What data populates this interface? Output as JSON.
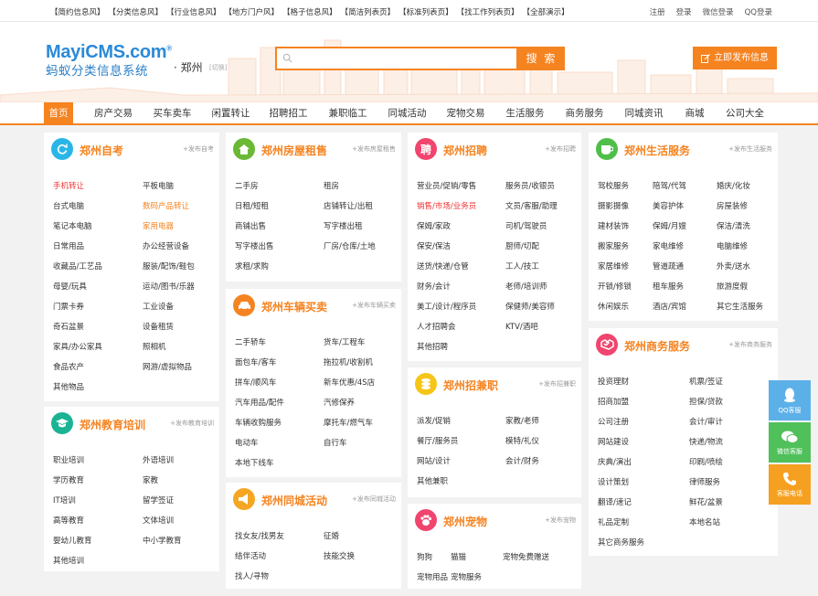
{
  "topbar": {
    "links": [
      "【简约信息风】",
      "【分类信息风】",
      "【行业信息风】",
      "【地方门户风】",
      "【格子信息风】",
      "【简洁列表页】",
      "【标准列表页】",
      "【找工作列表页】",
      "【全部演示】"
    ],
    "right": [
      "注册",
      "登录",
      "微信登录",
      "QQ登录"
    ]
  },
  "header": {
    "logo_main": "MayiCMS.com",
    "logo_reg": "®",
    "logo_sub": "蚂蚁分类信息系统",
    "city": "· 郑州",
    "switch_city": "[切换]",
    "search_placeholder": "",
    "search_button": "搜 索",
    "post_button": "立即发布信息"
  },
  "nav": [
    "首页",
    "房产交易",
    "买车卖车",
    "闲置转让",
    "招聘招工",
    "兼职临工",
    "同城活动",
    "宠物交易",
    "生活服务",
    "商务服务",
    "同城资讯",
    "商城",
    "公司大全"
  ],
  "colors": {
    "accent": "#f58320",
    "logo": "#2b8ad8",
    "hot": "#e33333"
  },
  "cards": {
    "exam": {
      "title": "郑州自考",
      "post": "+发布自考",
      "icon": "refresh-icon",
      "links": [
        "手机转让",
        "平板电脑",
        "台式电脑",
        "数码产品转让",
        "笔记本电脑",
        "家用电器",
        "日常用品",
        "办公经营设备",
        "收藏品/工艺品",
        "服装/配饰/鞋包",
        "母婴/玩具",
        "运动/图书/乐器",
        "门票卡券",
        "工业设备",
        "奇石盆景",
        "设备租赁",
        "家具/办公家具",
        "照相机",
        "食品农产",
        "网游/虚拟物品",
        "其他物品"
      ]
    },
    "edu": {
      "title": "郑州教育培训",
      "post": "+发布教育培训",
      "icon": "graduation-cap-icon",
      "links": [
        "职业培训",
        "外语培训",
        "学历教育",
        "家教",
        "IT培训",
        "留学签证",
        "高等教育",
        "文体培训",
        "婴幼儿教育",
        "中小学教育",
        "其他培训"
      ]
    },
    "house": {
      "title": "郑州房屋租售",
      "post": "+发布房屋租售",
      "icon": "house-icon",
      "links": [
        "二手房",
        "租房",
        "日租/短租",
        "店铺转让/出租",
        "商铺出售",
        "写字楼出租",
        "写字楼出售",
        "厂房/仓库/土地",
        "求租/求购"
      ]
    },
    "car": {
      "title": "郑州车辆买卖",
      "post": "+发布车辆买卖",
      "icon": "car-icon",
      "links": [
        "二手轿车",
        "货车/工程车",
        "面包车/客车",
        "拖拉机/收割机",
        "拼车/顺风车",
        "新车优惠/4S店",
        "汽车用品/配件",
        "汽修保养",
        "车辆收购服务",
        "摩托车/燃气车",
        "电动车",
        "自行车",
        "本地下线车"
      ]
    },
    "event": {
      "title": "郑州同城活动",
      "post": "+发布同城活动",
      "icon": "megaphone-icon",
      "links": [
        "找女友/找男友",
        "征婚",
        "结伴活动",
        "技能交换",
        "找人/寻物"
      ]
    },
    "jobs": {
      "title": "郑州招聘",
      "post": "+发布招聘",
      "icon": "hire-icon",
      "icon_text": "聘",
      "links": [
        "营业员/促销/零售",
        "服务员/收银员",
        "销售/市场/业务员",
        "文员/客服/助理",
        "保姆/家政",
        "司机/驾驶员",
        "保安/保洁",
        "厨师/切配",
        "送货/快递/仓管",
        "工人/技工",
        "财务/会计",
        "老师/培训师",
        "美工/设计/程序员",
        "保健师/美容师",
        "人才招聘会",
        "KTV/酒吧",
        "其他招聘"
      ]
    },
    "parttime": {
      "title": "郑州招兼职",
      "post": "+发布招兼职",
      "icon": "coins-icon",
      "links": [
        "派发/促销",
        "家教/老师",
        "餐厅/服务员",
        "模特/礼仪",
        "网站/设计",
        "会计/财务",
        "其他兼职"
      ]
    },
    "pets": {
      "title": "郑州宠物",
      "post": "+发布宠物",
      "icon": "pet-icon",
      "links": [
        "狗狗",
        "猫猫",
        "宠物免费赠送",
        "宠物用品",
        "宠物服务"
      ]
    },
    "life": {
      "title": "郑州生活服务",
      "post": "+发布生活服务",
      "icon": "cup-icon",
      "links": [
        "驾校服务",
        "陪驾/代驾",
        "婚庆/化妆",
        "摄影摄像",
        "美容护体",
        "房屋装修",
        "建材装饰",
        "保姆/月嫂",
        "保洁/清洗",
        "搬家服务",
        "家电维修",
        "电脑维修",
        "家居维修",
        "管道疏通",
        "外卖/送水",
        "开锁/修锁",
        "租车服务",
        "旅游度假",
        "休闲娱乐",
        "酒店/宾馆",
        "其它生活服务"
      ]
    },
    "biz": {
      "title": "郑州商务服务",
      "post": "+发布商务服务",
      "icon": "handshake-icon",
      "links": [
        "投资理财",
        "机票/签证",
        "招商加盟",
        "担保/贷款",
        "公司注册",
        "会计/审计",
        "网站建设",
        "快递/物流",
        "庆典/演出",
        "印刷/喷绘",
        "设计策划",
        "律师服务",
        "翻译/速记",
        "鲜花/盆景",
        "礼品定制",
        "本地名站",
        "其它商务服务"
      ]
    }
  },
  "float": {
    "qq": "QQ客服",
    "wechat": "微信客服",
    "phone": "客服电话"
  }
}
